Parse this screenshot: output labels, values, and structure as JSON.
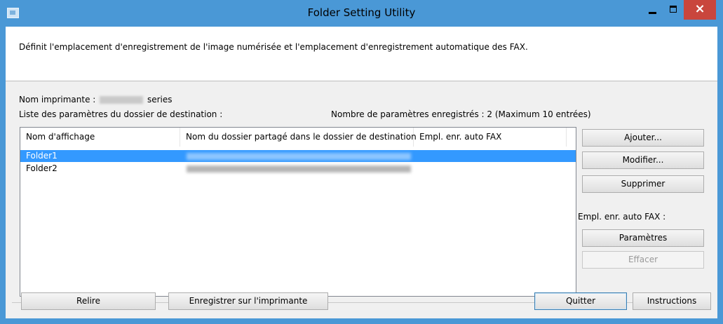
{
  "window": {
    "title": "Folder Setting Utility",
    "close_glyph": "×",
    "accent": "#4a98d6"
  },
  "description": "Définit l'emplacement d'enregistrement de l'image numérisée et l'emplacement d'enregistrement automatique des FAX.",
  "printer": {
    "label": "Nom imprimante :",
    "suffix": "series"
  },
  "list_label": "Liste des paramètres du dossier de destination :",
  "count_label": "Nombre de paramètres enregistrés : 2 (Maximum 10 entrées)",
  "table": {
    "columns": [
      "Nom d'affichage",
      "Nom du dossier partagé dans le dossier de destination",
      "Empl. enr. auto FAX"
    ],
    "rows": [
      {
        "name": "Folder1",
        "selected": true
      },
      {
        "name": "Folder2",
        "selected": false
      }
    ]
  },
  "side_buttons": {
    "add": "Ajouter...",
    "modify": "Modifier...",
    "delete": "Supprimer",
    "fax_label": "Empl. enr. auto FAX :",
    "settings": "Paramètres",
    "clear": "Effacer"
  },
  "bottom_buttons": {
    "reload": "Relire",
    "save_to_printer": "Enregistrer sur l'imprimante",
    "quit": "Quitter",
    "instructions": "Instructions"
  },
  "colors": {
    "selection": "#3399ff",
    "close_button": "#c9463d"
  }
}
